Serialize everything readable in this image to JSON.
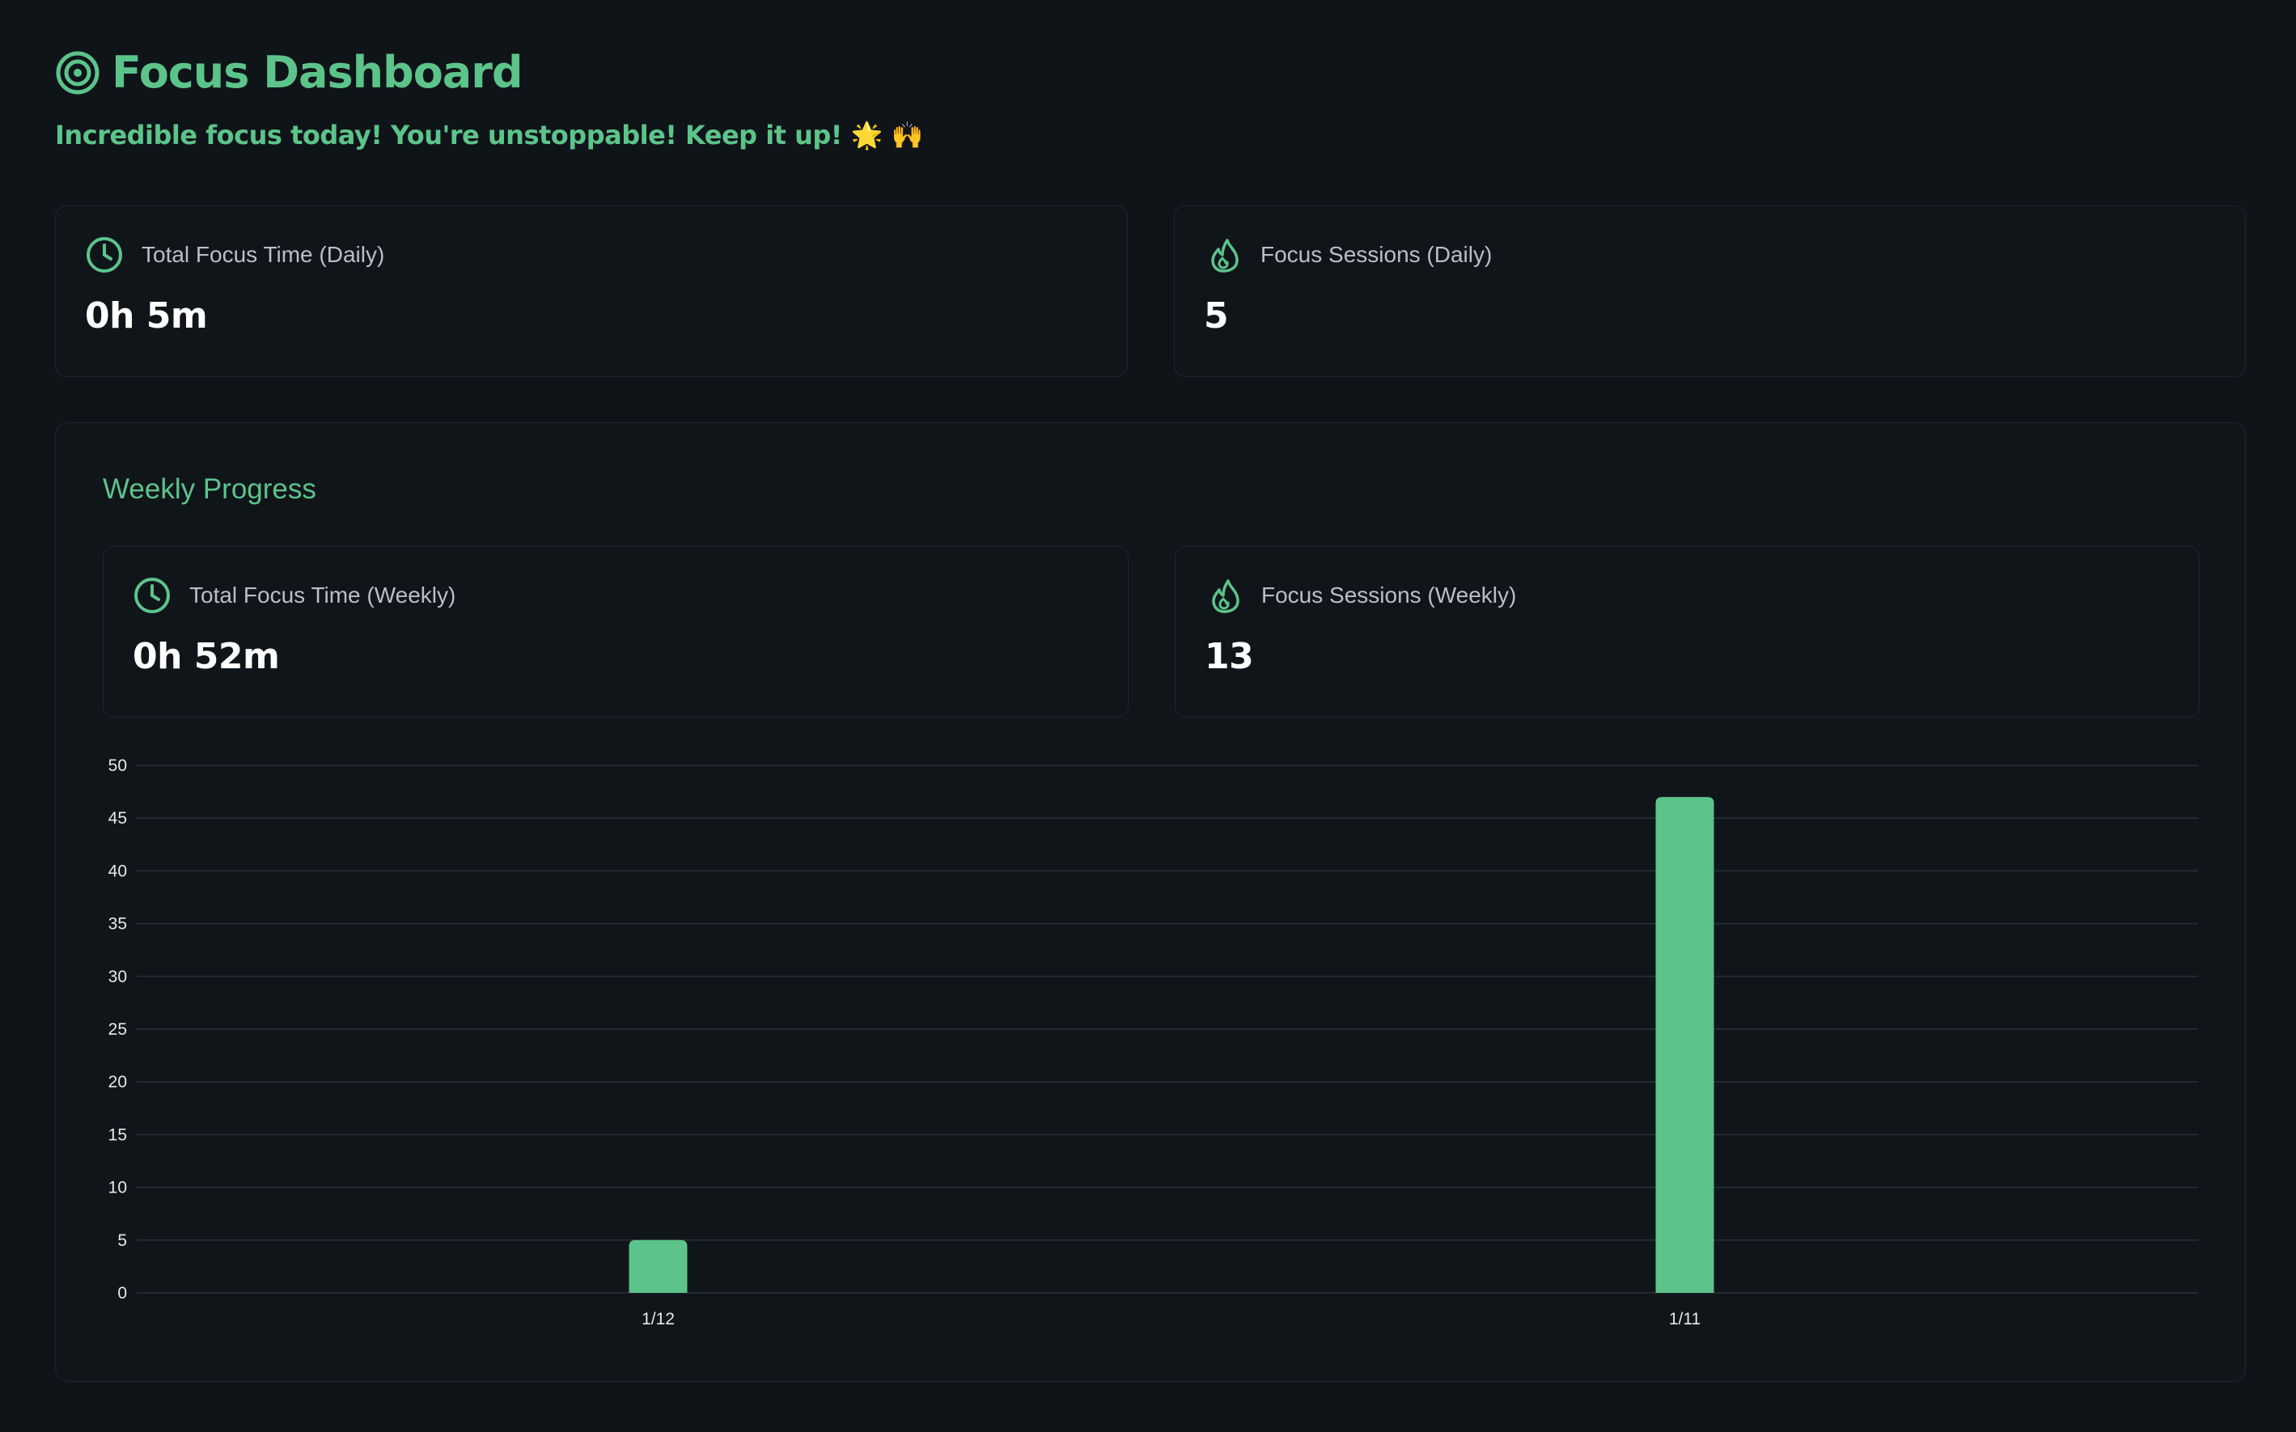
{
  "header": {
    "title": "Focus Dashboard",
    "subtitle": "Incredible focus today! You're unstoppable! Keep it up! 🌟 🙌"
  },
  "daily": {
    "time_card": {
      "icon": "clock-icon",
      "label": "Total Focus Time (Daily)",
      "value": "0h 5m"
    },
    "sessions_card": {
      "icon": "flame-icon",
      "label": "Focus Sessions (Daily)",
      "value": "5"
    }
  },
  "weekly": {
    "title": "Weekly Progress",
    "time_card": {
      "icon": "clock-icon",
      "label": "Total Focus Time (Weekly)",
      "value": "0h 52m"
    },
    "sessions_card": {
      "icon": "flame-icon",
      "label": "Focus Sessions (Weekly)",
      "value": "13"
    }
  },
  "colors": {
    "accent": "#5cc48a",
    "background": "#0f1419",
    "card_border": "#1f262d",
    "grid": "#2a3038"
  },
  "chart_data": {
    "type": "bar",
    "categories": [
      "1/12",
      "1/11"
    ],
    "values": [
      5,
      47
    ],
    "ylim": [
      0,
      50
    ],
    "yticks": [
      0,
      5,
      10,
      15,
      20,
      25,
      30,
      35,
      40,
      45,
      50
    ],
    "grid": true
  }
}
